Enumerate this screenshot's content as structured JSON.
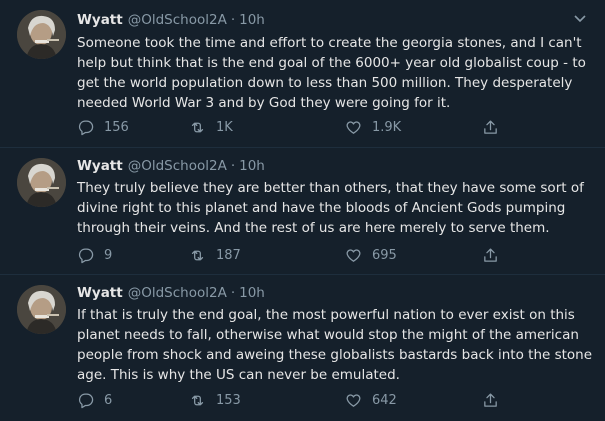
{
  "theme": {
    "background": "#15202b",
    "text": "#e6e6e6",
    "muted": "#8899a6"
  },
  "tweets": [
    {
      "name": "Wyatt",
      "handle": "@OldSchool2A",
      "separator": "·",
      "time": "10h",
      "text_lines": [
        "Someone took the time and effort to create the georgia stones, and I can't",
        "help but think that is the end goal of the 6000+ year old globalist coup - to",
        "get the world population down to less than 500 million. They desperately",
        "needed World War 3 and by God they were going for it."
      ],
      "replies": "156",
      "retweets": "1K",
      "likes": "1.9K"
    },
    {
      "name": "Wyatt",
      "handle": "@OldSchool2A",
      "separator": "·",
      "time": "10h",
      "text_lines": [
        "They truly believe they are better than others, that they have some sort of",
        "divine right to this planet and have the bloods of Ancient Gods pumping",
        "through their veins. And the rest of us are here merely to serve them."
      ],
      "replies": "9",
      "retweets": "187",
      "likes": "695"
    },
    {
      "name": "Wyatt",
      "handle": "@OldSchool2A",
      "separator": "·",
      "time": "10h",
      "text_lines": [
        "If that is truly the end goal, the most powerful nation to ever exist on this",
        "planet needs to fall, otherwise what would stop the might of the american",
        "people from shock and aweing these globalists bastards back into the stone",
        "age. This is why the US can never be emulated."
      ],
      "replies": "6",
      "retweets": "153",
      "likes": "642"
    }
  ],
  "icons": {
    "reply": "reply-icon",
    "retweet": "retweet-icon",
    "like": "heart-icon",
    "share": "share-icon",
    "more": "chevron-down-icon"
  }
}
